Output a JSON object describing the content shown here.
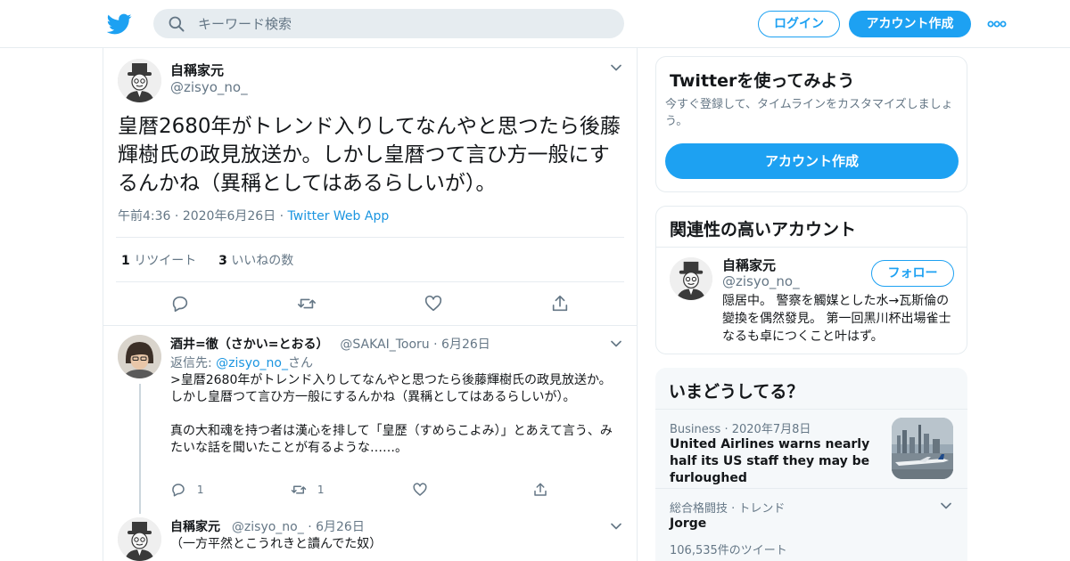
{
  "header": {
    "search_placeholder": "キーワード検索",
    "login_label": "ログイン",
    "signup_label": "アカウント作成"
  },
  "colors": {
    "accent": "#1da1f2",
    "link": "#1b95e0",
    "muted": "#657786",
    "border": "#e6ecf0"
  },
  "icons": [
    "twitter-bird-icon",
    "search-icon",
    "more-dots-icon",
    "chevron-down-icon",
    "reply-icon",
    "retweet-icon",
    "like-icon",
    "share-icon"
  ],
  "tweet": {
    "name": "自稱家元",
    "handle": "@zisyo_no_",
    "text": "皇暦2680年がトレンド入りしてなんやと思つたら後藤輝樹氏の政見放送か。しかし皇暦つて言ひ方一般にするんかね（異稱としてはあるらしいが）。",
    "time": "午前4:36",
    "date": "2020年6月26日",
    "app": "Twitter Web App",
    "retweets_count": "1",
    "retweets_label": "リツイート",
    "likes_count": "3",
    "likes_label": "いいねの数"
  },
  "reply1": {
    "name": "酒井=徹（さかい=とおる）",
    "handle": "@SAKAI_Tooru",
    "date": "6月26日",
    "replying_prefix": "返信先: ",
    "replying_to": "@zisyo_no_",
    "replying_suffix": "さん",
    "quote": ">皇暦2680年がトレンド入りしてなんやと思つたら後藤輝樹氏の政見放送か。しかし皇暦つて言ひ方一般にするんかね（異稱としてはあるらしいが）。",
    "body": "真の大和魂を持つ者は漢心を排して「皇歴（すめらこよみ）」とあえて言う、みたいな話を聞いたことが有るような……。",
    "reply_count": "1",
    "retweet_count": "1"
  },
  "reply2": {
    "name": "自稱家元",
    "handle": "@zisyo_no_",
    "date": "6月26日",
    "body": "（一方平然とこうれきと讀んでた奴）"
  },
  "signup_card": {
    "title": "Twitterを使ってみよう",
    "desc": "今すぐ登録して、タイムラインをカスタマイズしましょう。",
    "button": "アカウント作成"
  },
  "related": {
    "title": "関連性の高いアカウント",
    "name": "自稱家元",
    "handle": "@zisyo_no_",
    "follow": "フォロー",
    "bio": "隠居中。 警察を觸媒とした水→瓦斯倫の變換を偶然發見。 第一回黑川杯出場雀士なるも卓につくこと叶はず。"
  },
  "trends": {
    "title": "いまどうしてる？",
    "items": [
      {
        "category": "Business",
        "date": "2020年7月8日",
        "title": "United Airlines warns nearly half its US staff they may be furloughed"
      },
      {
        "category": "総合格闘技 · トレンド",
        "title": "Jorge",
        "count": "106,535件のツイート"
      }
    ]
  }
}
